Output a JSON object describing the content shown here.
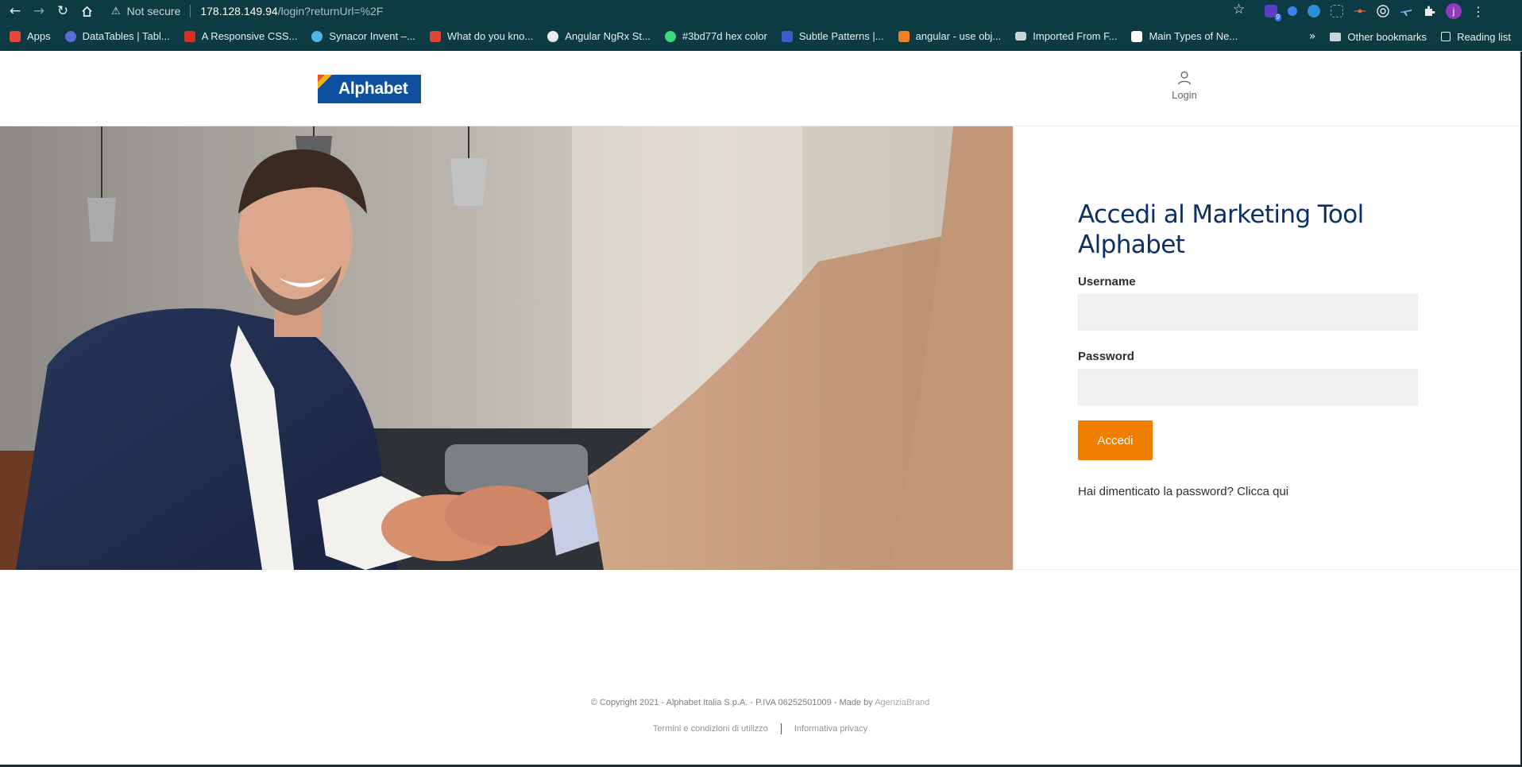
{
  "browser": {
    "security_label": "Not secure",
    "url_host": "178.128.149.94",
    "url_path": "/login?returnUrl=%2F",
    "extension_badge": "9",
    "profile_initial": "j",
    "bookmarks": [
      {
        "label": "Apps",
        "icon": "apps-grid-icon",
        "color": "#e8453c"
      },
      {
        "label": "DataTables | Tabl...",
        "icon": "datatables-icon",
        "color": "#5d6bd6"
      },
      {
        "label": "A Responsive CSS...",
        "icon": "heart-icon",
        "color": "#d93025"
      },
      {
        "label": "Synacor Invent –...",
        "icon": "synacor-icon",
        "color": "#4fb3e8"
      },
      {
        "label": "What do you kno...",
        "icon": "ux-icon",
        "color": "#e0453a"
      },
      {
        "label": "Angular NgRx St...",
        "icon": "globe-icon",
        "color": "#e8eef0"
      },
      {
        "label": "#3bd77d hex color",
        "icon": "color-wheel-icon",
        "color": "#3bd77d"
      },
      {
        "label": "Subtle Patterns |...",
        "icon": "subtle-patterns-icon",
        "color": "#3a5ec9"
      },
      {
        "label": "angular - use obj...",
        "icon": "stackoverflow-icon",
        "color": "#f48024"
      },
      {
        "label": "Imported From F...",
        "icon": "folder-icon",
        "color": "#c9d5d8"
      },
      {
        "label": "Main Types of Ne...",
        "icon": "medium-icon",
        "color": "#ffffff"
      }
    ],
    "other_bookmarks": "Other bookmarks",
    "reading_list": "Reading list"
  },
  "header": {
    "logo_text": "Alphabet",
    "login_label": "Login"
  },
  "login": {
    "title": "Accedi al Marketing Tool Alphabet",
    "username_label": "Username",
    "username_value": "",
    "password_label": "Password",
    "password_value": "",
    "submit_label": "Accedi",
    "forgot_text": "Hai dimenticato la password? Clicca qui"
  },
  "footer": {
    "copyright": "© Copyright 2021 - Alphabet Italia S.p.A. - P.IVA 06252501009 - Made by",
    "made_by": "AgenziaBrand",
    "terms": "Termini e condizioni di utilizzo",
    "privacy": "Informativa privacy"
  },
  "colors": {
    "chrome": "#0d3b44",
    "brand_blue": "#0f4f9f",
    "title_navy": "#0b2f66",
    "accent_orange": "#f07d00"
  }
}
